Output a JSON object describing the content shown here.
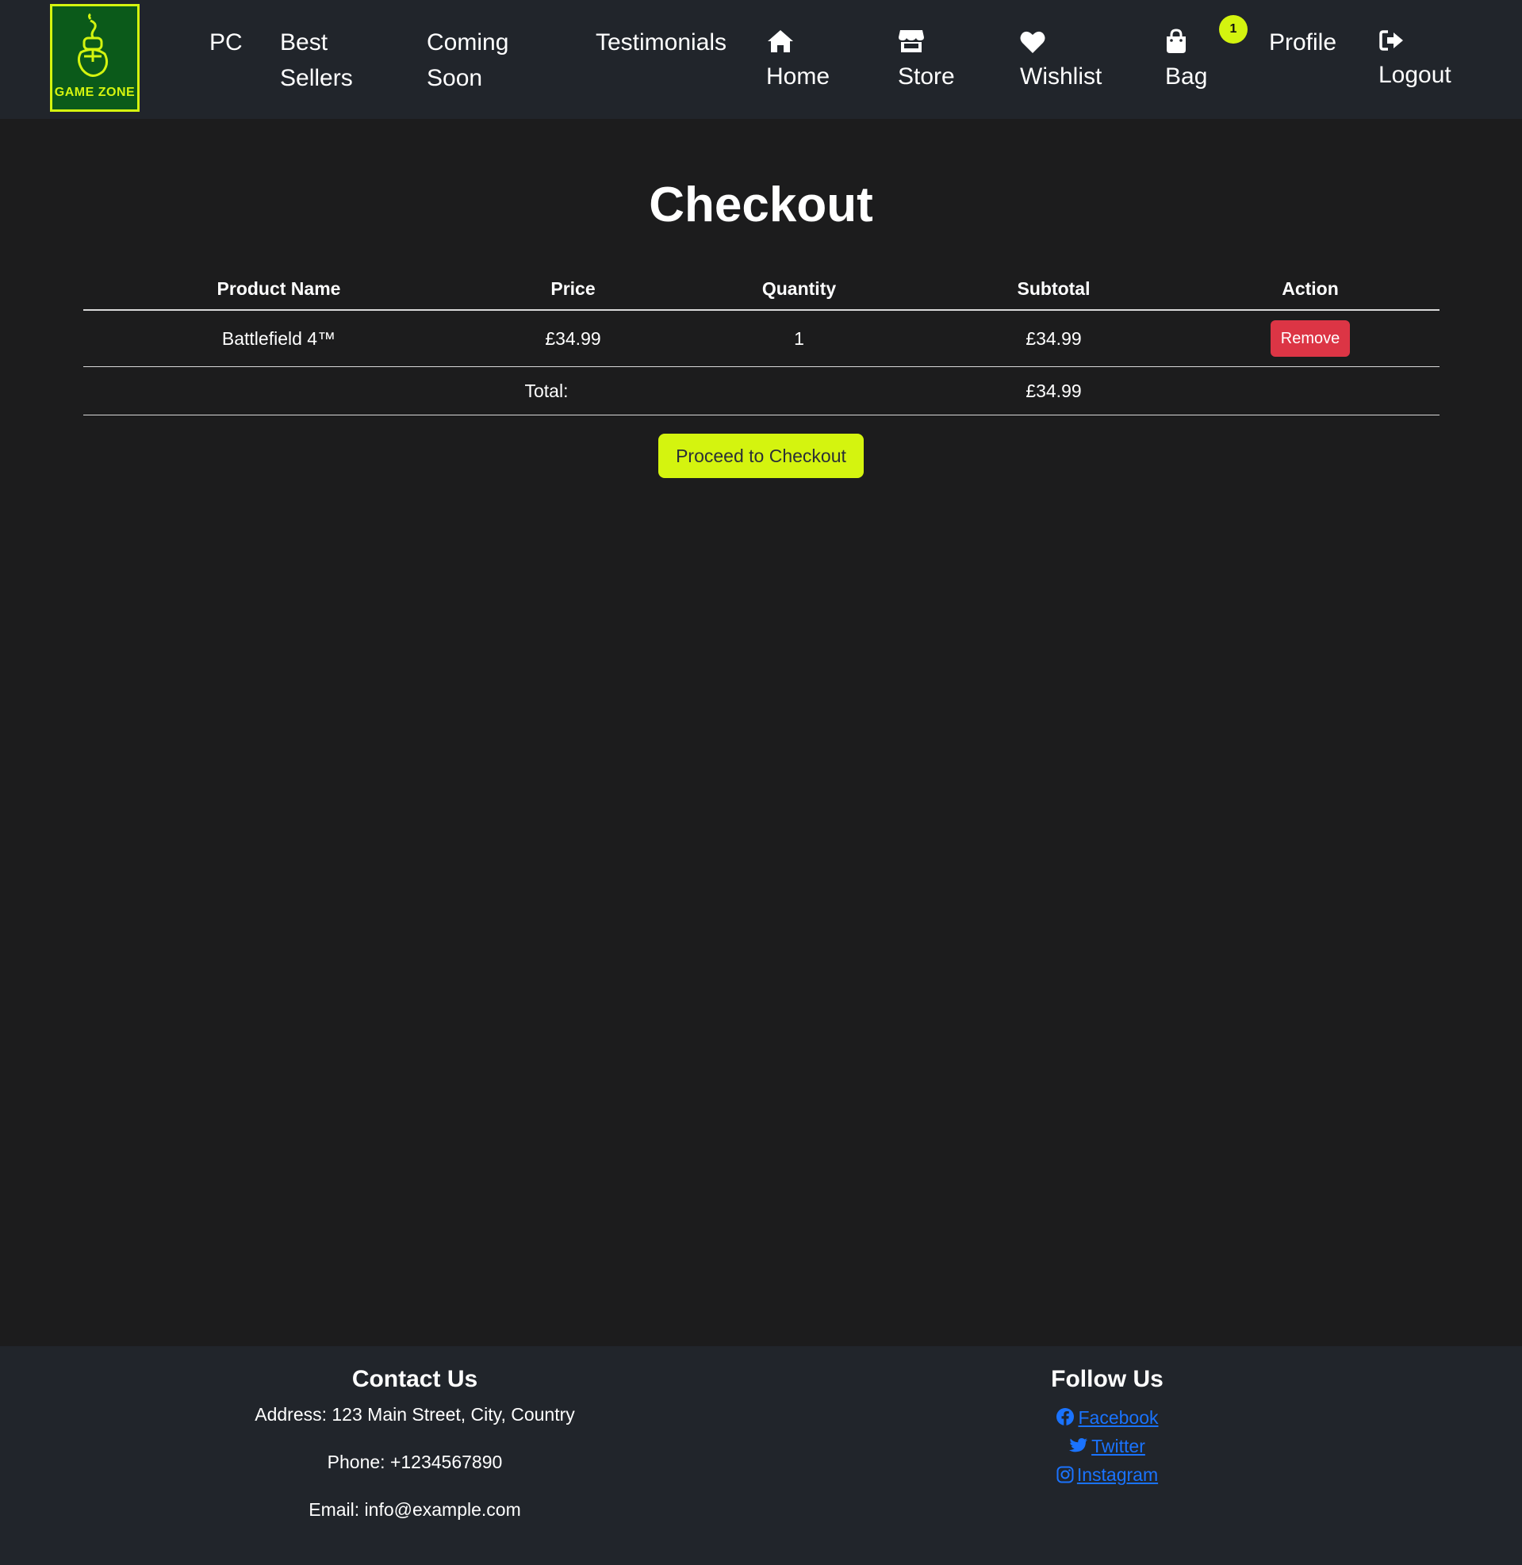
{
  "brand": {
    "logo_text": "GAME ZONE",
    "accent_color": "#d4f40f",
    "logo_bg": "#0b5a1a"
  },
  "nav": {
    "pc": "PC",
    "best_sellers_line1": "Best",
    "best_sellers_line2": "Sellers",
    "coming_soon_line1": "Coming",
    "coming_soon_line2": "Soon",
    "testimonials": "Testimonials",
    "home": {
      "label": "Home",
      "icon": "home-icon"
    },
    "store": {
      "label": "Store",
      "icon": "store-icon"
    },
    "wishlist": {
      "label": "Wishlist",
      "icon": "heart-icon"
    },
    "bag": {
      "label": "Bag",
      "icon": "shopping-bag-icon",
      "badge_count": "1"
    },
    "profile": "Profile",
    "logout": {
      "label": "Logout",
      "icon": "sign-out-icon"
    }
  },
  "checkout": {
    "title": "Checkout",
    "columns": [
      "Product Name",
      "Price",
      "Quantity",
      "Subtotal",
      "Action"
    ],
    "items": [
      {
        "name": "Battlefield 4™",
        "price": "£34.99",
        "quantity": "1",
        "subtotal": "£34.99",
        "action": "Remove"
      }
    ],
    "total_label": "Total:",
    "total_value": "£34.99",
    "proceed_button": "Proceed to Checkout",
    "remove_color": "#dc3545"
  },
  "footer": {
    "contact": {
      "heading": "Contact Us",
      "address": "Address: 123 Main Street, City, Country",
      "phone": "Phone: +1234567890",
      "email": "Email: info@example.com"
    },
    "follow": {
      "heading": "Follow Us",
      "links": [
        {
          "label": "Facebook",
          "icon": "facebook-icon"
        },
        {
          "label": "Twitter",
          "icon": "twitter-icon"
        },
        {
          "label": "Instagram",
          "icon": "instagram-icon"
        }
      ],
      "link_color": "#1a73ff"
    }
  }
}
